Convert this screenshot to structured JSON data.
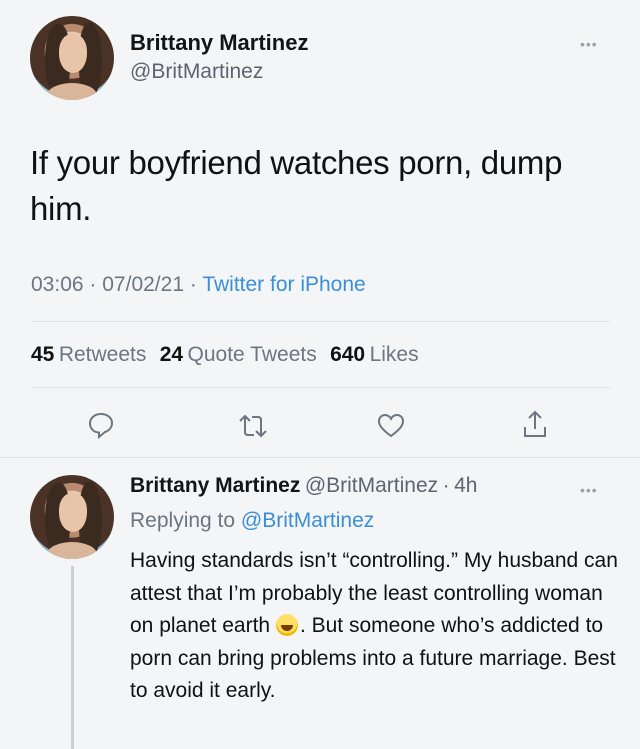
{
  "main_tweet": {
    "author_name": "Brittany Martinez",
    "author_handle": "@BritMartinez",
    "more_label": "•••",
    "text": "If your boyfriend watches porn, dump him.",
    "time": "03:06",
    "date": "07/02/21",
    "source": "Twitter for iPhone",
    "separator": "·"
  },
  "stats": {
    "retweets_count": "45",
    "retweets_label": "Retweets",
    "quotes_count": "24",
    "quotes_label": "Quote Tweets",
    "likes_count": "640",
    "likes_label": "Likes"
  },
  "actions": [
    "reply-icon",
    "retweet-icon",
    "like-icon",
    "share-icon"
  ],
  "reply": {
    "author_name": "Brittany Martinez",
    "author_handle": "@BritMartinez",
    "age": "4h",
    "separator": "·",
    "more_label": "•••",
    "replying_prefix": "Replying to",
    "replying_to": "@BritMartinez",
    "text_before_emoji": "Having standards isn’t “controlling.” My husband can attest that I’m probably the least controlling woman on planet earth",
    "emoji": "joy-emoji",
    "text_after_emoji": ". But someone who’s addicted to porn can bring problems into a future marriage. Best to avoid it early."
  },
  "colors": {
    "background": "#f4f5f7",
    "link": "#3a8fd6",
    "muted": "#6b7680"
  }
}
